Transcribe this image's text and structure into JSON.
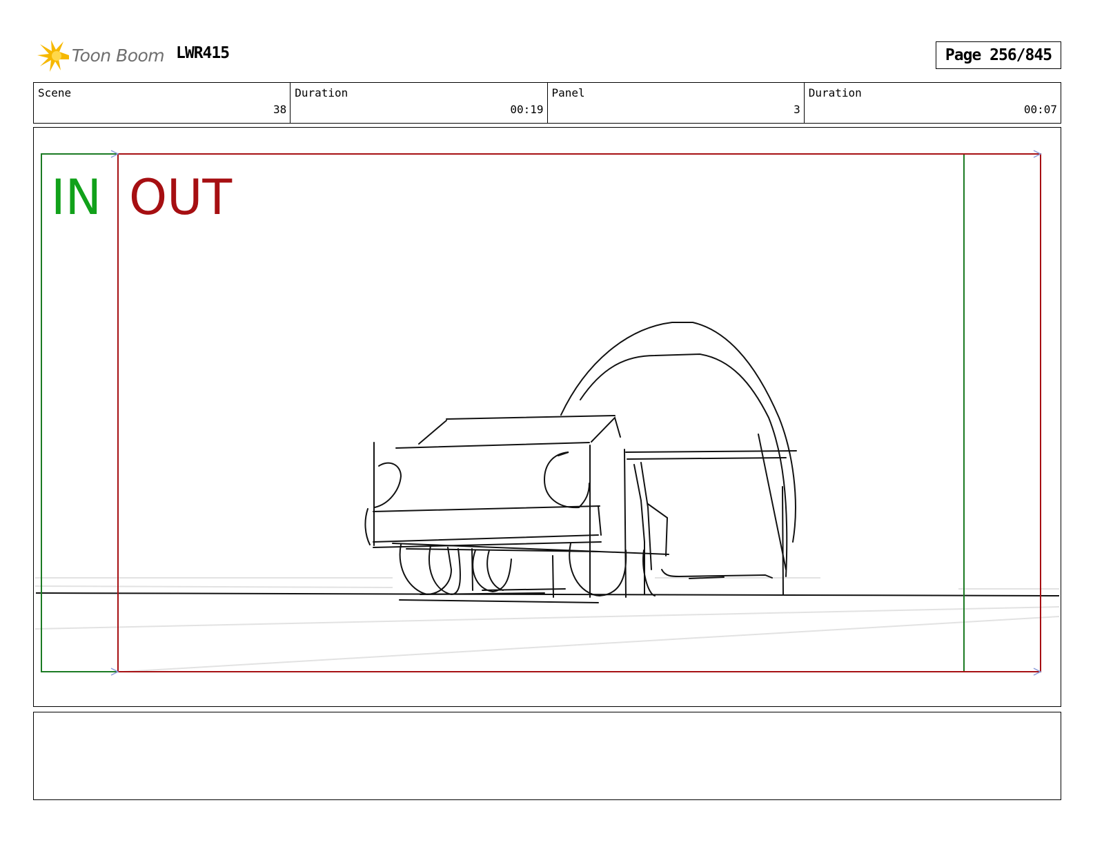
{
  "header": {
    "brand": "Toon Boom",
    "project": "LWR415",
    "page_label": "Page 256/845"
  },
  "info": {
    "scene_label": "Scene",
    "scene_value": "38",
    "scene_duration_label": "Duration",
    "scene_duration_value": "00:19",
    "panel_label": "Panel",
    "panel_value": "3",
    "panel_duration_label": "Duration",
    "panel_duration_value": "00:07"
  },
  "panel": {
    "in_label": "IN",
    "out_label": "OUT",
    "colors": {
      "in": "#11a11a",
      "out": "#a60f12",
      "guide": "#8a9ad8"
    }
  },
  "notes": {
    "text": ""
  },
  "icons": {
    "logo": "sunburst-logo-icon"
  }
}
